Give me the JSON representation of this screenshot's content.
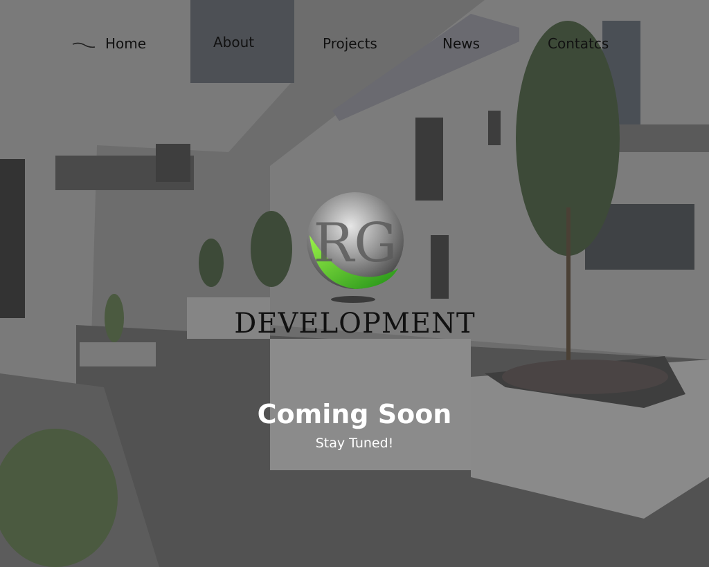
{
  "nav": {
    "items": [
      {
        "label": "Home"
      },
      {
        "label": "About"
      },
      {
        "label": "Projects"
      },
      {
        "label": "News"
      },
      {
        "label": "Contatcs"
      }
    ]
  },
  "logo": {
    "monogram": "RG",
    "wordmark": "DEVELOPMENT",
    "accent_color": "#3fbf2b"
  },
  "hero": {
    "headline": "Coming Soon",
    "subtitle": "Stay Tuned!"
  },
  "colors": {
    "overlay": "#00000055",
    "text_light": "#ffffff",
    "text_dark": "#111111"
  }
}
